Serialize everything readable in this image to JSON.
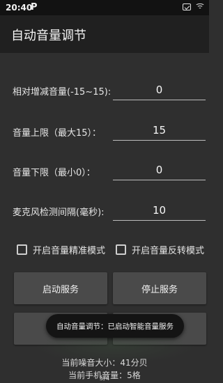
{
  "status_bar": {
    "time": "20:40",
    "app_indicator": "P",
    "icons": [
      "p-notification-icon",
      "sim-alert-icon",
      "wifi-icon"
    ]
  },
  "app_bar": {
    "title": "自动音量调节"
  },
  "fields": [
    {
      "label": "相对增减音量(-15~15):",
      "value": "0"
    },
    {
      "label": "音量上限（最大15）：",
      "value": "15"
    },
    {
      "label": "音量下限（最小0）：",
      "value": "0"
    },
    {
      "label": "麦克风检测间隔(毫秒):",
      "value": "10"
    }
  ],
  "checkboxes": [
    {
      "label": "开启音量精准模式",
      "checked": false
    },
    {
      "label": "开启音量反转模式",
      "checked": false
    }
  ],
  "buttons": {
    "start": "启动服务",
    "stop": "停止服务"
  },
  "toast": {
    "text": "自动音量调节：已启动智能音量服务"
  },
  "info": {
    "noise": "当前噪音大小：41分贝",
    "phone_volume": "当前手机音量：5格",
    "pager": "5/4"
  },
  "colors": {
    "background": "#2f2f2f",
    "app_bar": "#202020",
    "status_bar": "#121212",
    "button": "#4a4a4a",
    "toast": "#141414"
  }
}
